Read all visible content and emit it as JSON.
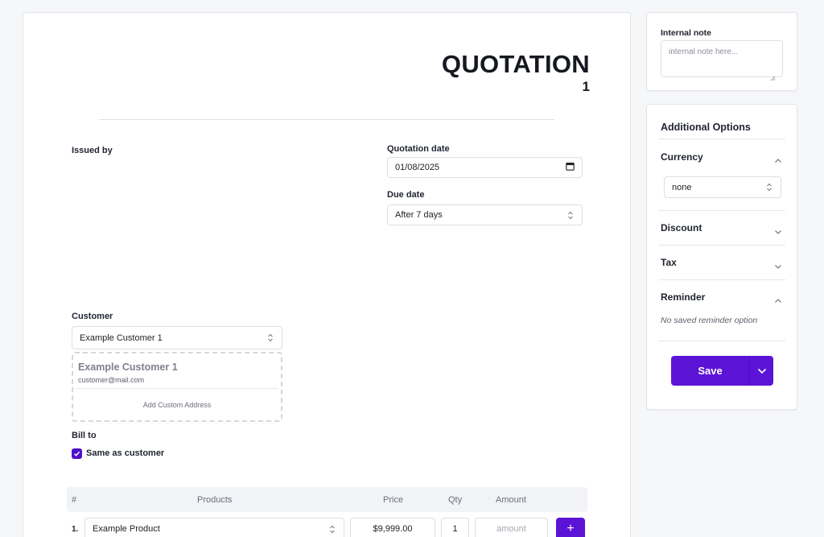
{
  "document": {
    "title": "QUOTATION",
    "number": "1",
    "issued_by_label": "Issued by",
    "quotation_date_label": "Quotation date",
    "quotation_date_value": "01/08/2025",
    "due_date_label": "Due date",
    "due_date_value": "After 7 days",
    "customer_label": "Customer",
    "customer_select_value": "Example Customer 1",
    "customer_card": {
      "name": "Example Customer 1",
      "email": "customer@mail.com",
      "add_address_label": "Add Custom Address"
    },
    "bill_to_label": "Bill to",
    "same_as_customer_label": "Same as customer",
    "same_as_customer_checked": true
  },
  "items_table": {
    "headers": [
      "#",
      "Products",
      "Price",
      "Qty",
      "Amount"
    ],
    "rows": [
      {
        "num": "1.",
        "product": "Example Product",
        "price": "$9,999.00",
        "qty": "1",
        "amount_placeholder": "amount"
      }
    ],
    "add_button_label": "+"
  },
  "internal_note": {
    "label": "Internal note",
    "placeholder": "internal note here..."
  },
  "options": {
    "title": "Additional Options",
    "currency_label": "Currency",
    "currency_value": "none",
    "discount_label": "Discount",
    "tax_label": "Tax",
    "reminder_label": "Reminder",
    "reminder_empty": "No saved reminder option",
    "save_label": "Save"
  },
  "colors": {
    "accent": "#5b14d6",
    "checkbox": "#4f0fc9"
  }
}
